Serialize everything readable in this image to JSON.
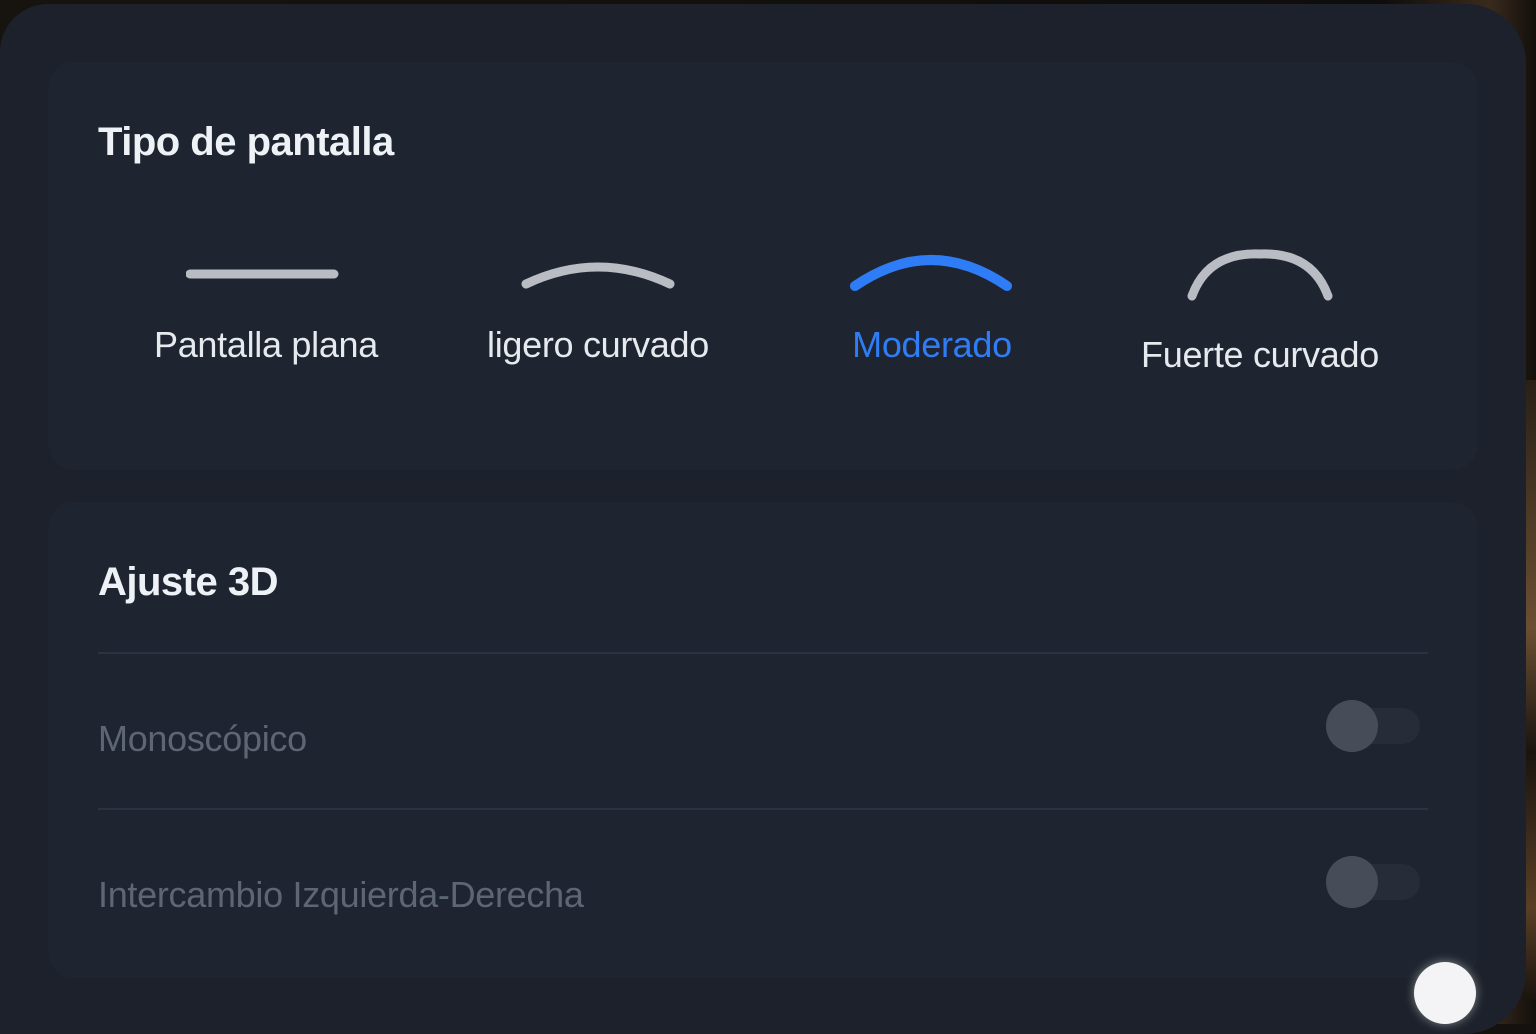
{
  "screen_type": {
    "title": "Tipo de pantalla",
    "options": [
      {
        "label": "Pantalla plana",
        "icon": "flat-screen-icon",
        "selected": false
      },
      {
        "label": "ligero curvado",
        "icon": "slight-curve-icon",
        "selected": false
      },
      {
        "label": "Moderado",
        "icon": "moderate-curve-icon",
        "selected": true
      },
      {
        "label": "Fuerte curvado",
        "icon": "strong-curve-icon",
        "selected": false
      }
    ]
  },
  "adjust_3d": {
    "title": "Ajuste 3D",
    "rows": [
      {
        "label": "Monoscópico",
        "enabled": false,
        "disabled": true
      },
      {
        "label": "Intercambio Izquierda-Derecha",
        "enabled": false,
        "disabled": true
      }
    ]
  },
  "colors": {
    "accent": "#2f7df6",
    "panel": "#1c212b",
    "card": "#1f2530",
    "icon_inactive": "#b9bcc2"
  }
}
